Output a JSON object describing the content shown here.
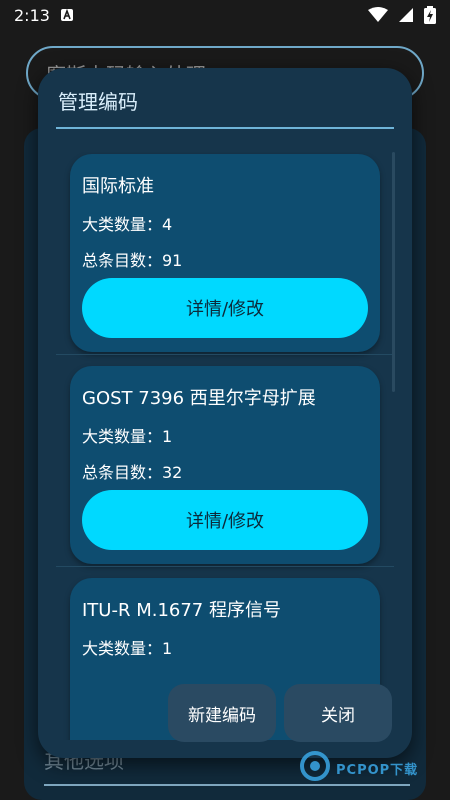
{
  "status_bar": {
    "time": "2:13",
    "icons": [
      "notification-a-icon",
      "wifi-icon",
      "signal-icon",
      "battery-charging-icon"
    ]
  },
  "background": {
    "input_text": "摩斯电码输入处理",
    "bottom_label": "其他选项"
  },
  "dialog": {
    "title": "管理编码",
    "cards": [
      {
        "name": "国际标准",
        "categories": "大类数量：4",
        "total": "总条目数：91",
        "button": "详情/修改"
      },
      {
        "name": "GOST 7396 西里尔字母扩展",
        "categories": "大类数量：1",
        "total": "总条目数：32",
        "button": "详情/修改"
      },
      {
        "name": "ITU-R M.1677 程序信号",
        "categories": "大类数量：1",
        "total": "",
        "button": ""
      }
    ],
    "actions": {
      "new": "新建编码",
      "close": "关闭"
    }
  },
  "watermark": {
    "text": "PCPOP下载"
  },
  "colors": {
    "accent": "#00d9ff",
    "dialog_bg": "#16354b",
    "card_bg": "#0e4d70"
  }
}
